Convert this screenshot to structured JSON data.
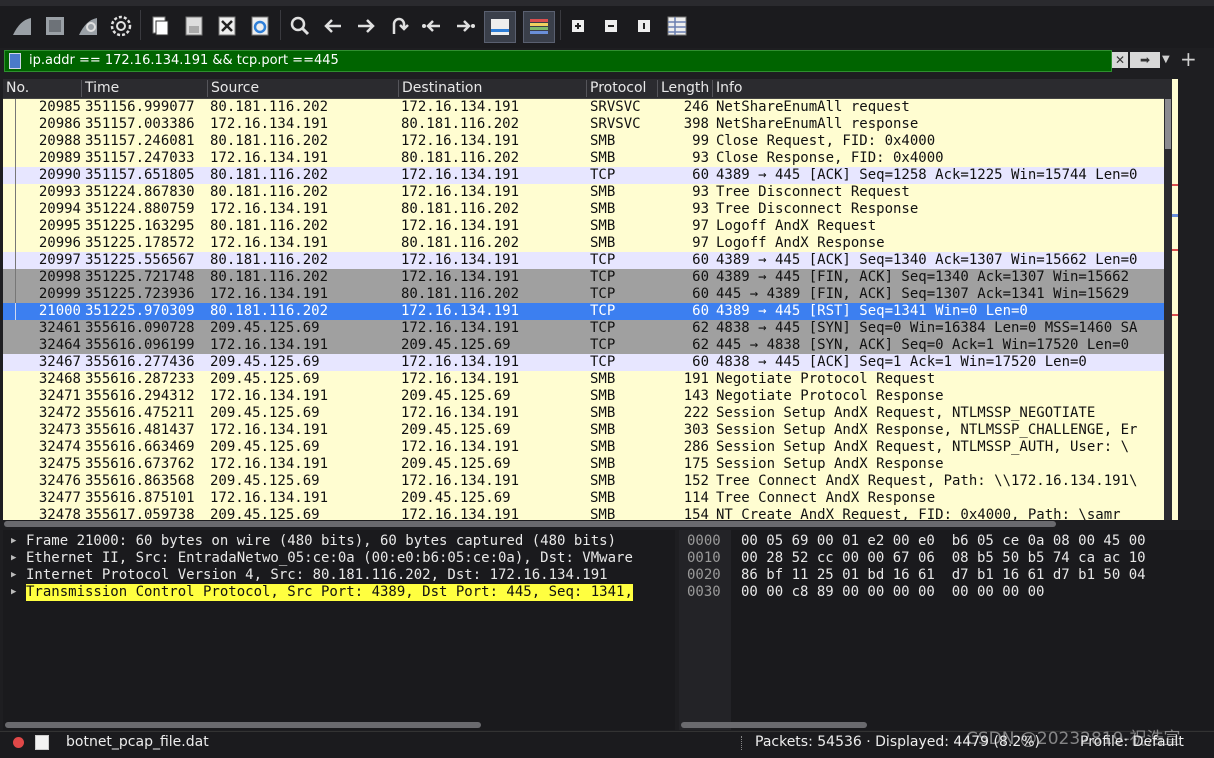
{
  "filter": {
    "expression": "ip.addr == 172.16.134.191 && tcp.port ==445"
  },
  "columns": [
    "No.",
    "Time",
    "Source",
    "Destination",
    "Protocol",
    "Length",
    "Info"
  ],
  "packets": [
    {
      "no": "20985",
      "time": "351156.999077",
      "src": "80.181.116.202",
      "dst": "172.16.134.191",
      "proto": "SRVSVC",
      "len": "246",
      "info": "NetShareEnumAll request",
      "bg": "#fffdd1",
      "fg": "#111111"
    },
    {
      "no": "20986",
      "time": "351157.003386",
      "src": "172.16.134.191",
      "dst": "80.181.116.202",
      "proto": "SRVSVC",
      "len": "398",
      "info": "NetShareEnumAll response",
      "bg": "#fffdd1",
      "fg": "#111111"
    },
    {
      "no": "20988",
      "time": "351157.246081",
      "src": "80.181.116.202",
      "dst": "172.16.134.191",
      "proto": "SMB",
      "len": "99",
      "info": "Close Request, FID: 0x4000",
      "bg": "#fffdd1",
      "fg": "#111111"
    },
    {
      "no": "20989",
      "time": "351157.247033",
      "src": "172.16.134.191",
      "dst": "80.181.116.202",
      "proto": "SMB",
      "len": "93",
      "info": "Close Response, FID: 0x4000",
      "bg": "#fffdd1",
      "fg": "#111111"
    },
    {
      "no": "20990",
      "time": "351157.651805",
      "src": "80.181.116.202",
      "dst": "172.16.134.191",
      "proto": "TCP",
      "len": "60",
      "info": "4389 → 445 [ACK] Seq=1258 Ack=1225 Win=15744 Len=0",
      "bg": "#e7e6ff",
      "fg": "#111111"
    },
    {
      "no": "20993",
      "time": "351224.867830",
      "src": "80.181.116.202",
      "dst": "172.16.134.191",
      "proto": "SMB",
      "len": "93",
      "info": "Tree Disconnect Request",
      "bg": "#fffdd1",
      "fg": "#111111"
    },
    {
      "no": "20994",
      "time": "351224.880759",
      "src": "172.16.134.191",
      "dst": "80.181.116.202",
      "proto": "SMB",
      "len": "93",
      "info": "Tree Disconnect Response",
      "bg": "#fffdd1",
      "fg": "#111111"
    },
    {
      "no": "20995",
      "time": "351225.163295",
      "src": "80.181.116.202",
      "dst": "172.16.134.191",
      "proto": "SMB",
      "len": "97",
      "info": "Logoff AndX Request",
      "bg": "#fffdd1",
      "fg": "#111111"
    },
    {
      "no": "20996",
      "time": "351225.178572",
      "src": "172.16.134.191",
      "dst": "80.181.116.202",
      "proto": "SMB",
      "len": "97",
      "info": "Logoff AndX Response",
      "bg": "#fffdd1",
      "fg": "#111111"
    },
    {
      "no": "20997",
      "time": "351225.556567",
      "src": "80.181.116.202",
      "dst": "172.16.134.191",
      "proto": "TCP",
      "len": "60",
      "info": "4389 → 445 [ACK] Seq=1340 Ack=1307 Win=15662 Len=0",
      "bg": "#e7e6ff",
      "fg": "#111111"
    },
    {
      "no": "20998",
      "time": "351225.721748",
      "src": "80.181.116.202",
      "dst": "172.16.134.191",
      "proto": "TCP",
      "len": "60",
      "info": "4389 → 445 [FIN, ACK] Seq=1340 Ack=1307 Win=15662",
      "bg": "#a0a0a0",
      "fg": "#111111"
    },
    {
      "no": "20999",
      "time": "351225.723936",
      "src": "172.16.134.191",
      "dst": "80.181.116.202",
      "proto": "TCP",
      "len": "60",
      "info": "445 → 4389 [FIN, ACK] Seq=1307 Ack=1341 Win=15629",
      "bg": "#a0a0a0",
      "fg": "#111111"
    },
    {
      "no": "21000",
      "time": "351225.970309",
      "src": "80.181.116.202",
      "dst": "172.16.134.191",
      "proto": "TCP",
      "len": "60",
      "info": "4389 → 445 [RST] Seq=1341 Win=0 Len=0",
      "bg": "#3c7ff0",
      "fg": "#ffffff",
      "selected": true
    },
    {
      "no": "32461",
      "time": "355616.090728",
      "src": "209.45.125.69",
      "dst": "172.16.134.191",
      "proto": "TCP",
      "len": "62",
      "info": "4838 → 445 [SYN] Seq=0 Win=16384 Len=0 MSS=1460 SA",
      "bg": "#a0a0a0",
      "fg": "#111111"
    },
    {
      "no": "32464",
      "time": "355616.096199",
      "src": "172.16.134.191",
      "dst": "209.45.125.69",
      "proto": "TCP",
      "len": "62",
      "info": "445 → 4838 [SYN, ACK] Seq=0 Ack=1 Win=17520 Len=0",
      "bg": "#a0a0a0",
      "fg": "#111111"
    },
    {
      "no": "32467",
      "time": "355616.277436",
      "src": "209.45.125.69",
      "dst": "172.16.134.191",
      "proto": "TCP",
      "len": "60",
      "info": "4838 → 445 [ACK] Seq=1 Ack=1 Win=17520 Len=0",
      "bg": "#e7e6ff",
      "fg": "#111111"
    },
    {
      "no": "32468",
      "time": "355616.287233",
      "src": "209.45.125.69",
      "dst": "172.16.134.191",
      "proto": "SMB",
      "len": "191",
      "info": "Negotiate Protocol Request",
      "bg": "#fffdd1",
      "fg": "#111111"
    },
    {
      "no": "32471",
      "time": "355616.294312",
      "src": "172.16.134.191",
      "dst": "209.45.125.69",
      "proto": "SMB",
      "len": "143",
      "info": "Negotiate Protocol Response",
      "bg": "#fffdd1",
      "fg": "#111111"
    },
    {
      "no": "32472",
      "time": "355616.475211",
      "src": "209.45.125.69",
      "dst": "172.16.134.191",
      "proto": "SMB",
      "len": "222",
      "info": "Session Setup AndX Request, NTLMSSP_NEGOTIATE",
      "bg": "#fffdd1",
      "fg": "#111111"
    },
    {
      "no": "32473",
      "time": "355616.481437",
      "src": "172.16.134.191",
      "dst": "209.45.125.69",
      "proto": "SMB",
      "len": "303",
      "info": "Session Setup AndX Response, NTLMSSP_CHALLENGE, Er",
      "bg": "#fffdd1",
      "fg": "#111111"
    },
    {
      "no": "32474",
      "time": "355616.663469",
      "src": "209.45.125.69",
      "dst": "172.16.134.191",
      "proto": "SMB",
      "len": "286",
      "info": "Session Setup AndX Request, NTLMSSP_AUTH, User: \\",
      "bg": "#fffdd1",
      "fg": "#111111"
    },
    {
      "no": "32475",
      "time": "355616.673762",
      "src": "172.16.134.191",
      "dst": "209.45.125.69",
      "proto": "SMB",
      "len": "175",
      "info": "Session Setup AndX Response",
      "bg": "#fffdd1",
      "fg": "#111111"
    },
    {
      "no": "32476",
      "time": "355616.863568",
      "src": "209.45.125.69",
      "dst": "172.16.134.191",
      "proto": "SMB",
      "len": "152",
      "info": "Tree Connect AndX Request, Path: \\\\172.16.134.191\\",
      "bg": "#fffdd1",
      "fg": "#111111"
    },
    {
      "no": "32477",
      "time": "355616.875101",
      "src": "172.16.134.191",
      "dst": "209.45.125.69",
      "proto": "SMB",
      "len": "114",
      "info": "Tree Connect AndX Response",
      "bg": "#fffdd1",
      "fg": "#111111"
    },
    {
      "no": "32478",
      "time": "355617.059738",
      "src": "209.45.125.69",
      "dst": "172.16.134.191",
      "proto": "SMB",
      "len": "154",
      "info": "NT Create AndX Request, FID: 0x4000, Path: \\samr",
      "bg": "#fffdd1",
      "fg": "#111111"
    }
  ],
  "details": [
    {
      "text": "Frame 21000: 60 bytes on wire (480 bits), 60 bytes captured (480 bits)",
      "highlighted": false
    },
    {
      "text": "Ethernet II, Src: EntradaNetwo_05:ce:0a (00:e0:b6:05:ce:0a), Dst: VMware",
      "highlighted": false
    },
    {
      "text": "Internet Protocol Version 4, Src: 80.181.116.202, Dst: 172.16.134.191",
      "highlighted": false
    },
    {
      "text": "Transmission Control Protocol, Src Port: 4389, Dst Port: 445, Seq: 1341,",
      "highlighted": true
    }
  ],
  "bytes": [
    {
      "offset": "0000",
      "hex": "00 05 69 00 01 e2 00 e0  b6 05 ce 0a 08 00 45 00"
    },
    {
      "offset": "0010",
      "hex": "00 28 52 cc 00 00 67 06  08 b5 50 b5 74 ca ac 10"
    },
    {
      "offset": "0020",
      "hex": "86 bf 11 25 01 bd 16 61  d7 b1 16 61 d7 b1 50 04"
    },
    {
      "offset": "0030",
      "hex": "00 00 c8 89 00 00 00 00  00 00 00 00"
    }
  ],
  "status": {
    "file_name": "botnet_pcap_file.dat",
    "packets": "Packets: 54536 · Displayed: 4479 (8.2%)",
    "profile": "Profile: Default",
    "watermark": "CSDN @20232819-祝浩宣"
  },
  "colors": {
    "filter_valid_bg": "#006400",
    "selected_row": "#3c7ff0",
    "smb_row": "#fffdd1",
    "tcp_row": "#e7e6ff",
    "tcp_flags_row": "#a0a0a0",
    "detail_highlight": "#ffff40"
  },
  "toolbar_icons": [
    "shark-fin-start-icon",
    "stop-square-icon",
    "shark-fin-restart-icon",
    "gear-options-icon",
    "open-file-icon",
    "save-file-icon",
    "close-file-icon",
    "reload-file-icon",
    "search-icon",
    "back-arrow-icon",
    "forward-arrow-icon",
    "goto-packet-icon",
    "first-packet-icon",
    "last-packet-icon",
    "autoscroll-icon",
    "colorize-icon",
    "zoom-in-icon",
    "zoom-out-icon",
    "normal-size-icon",
    "resize-columns-icon"
  ]
}
